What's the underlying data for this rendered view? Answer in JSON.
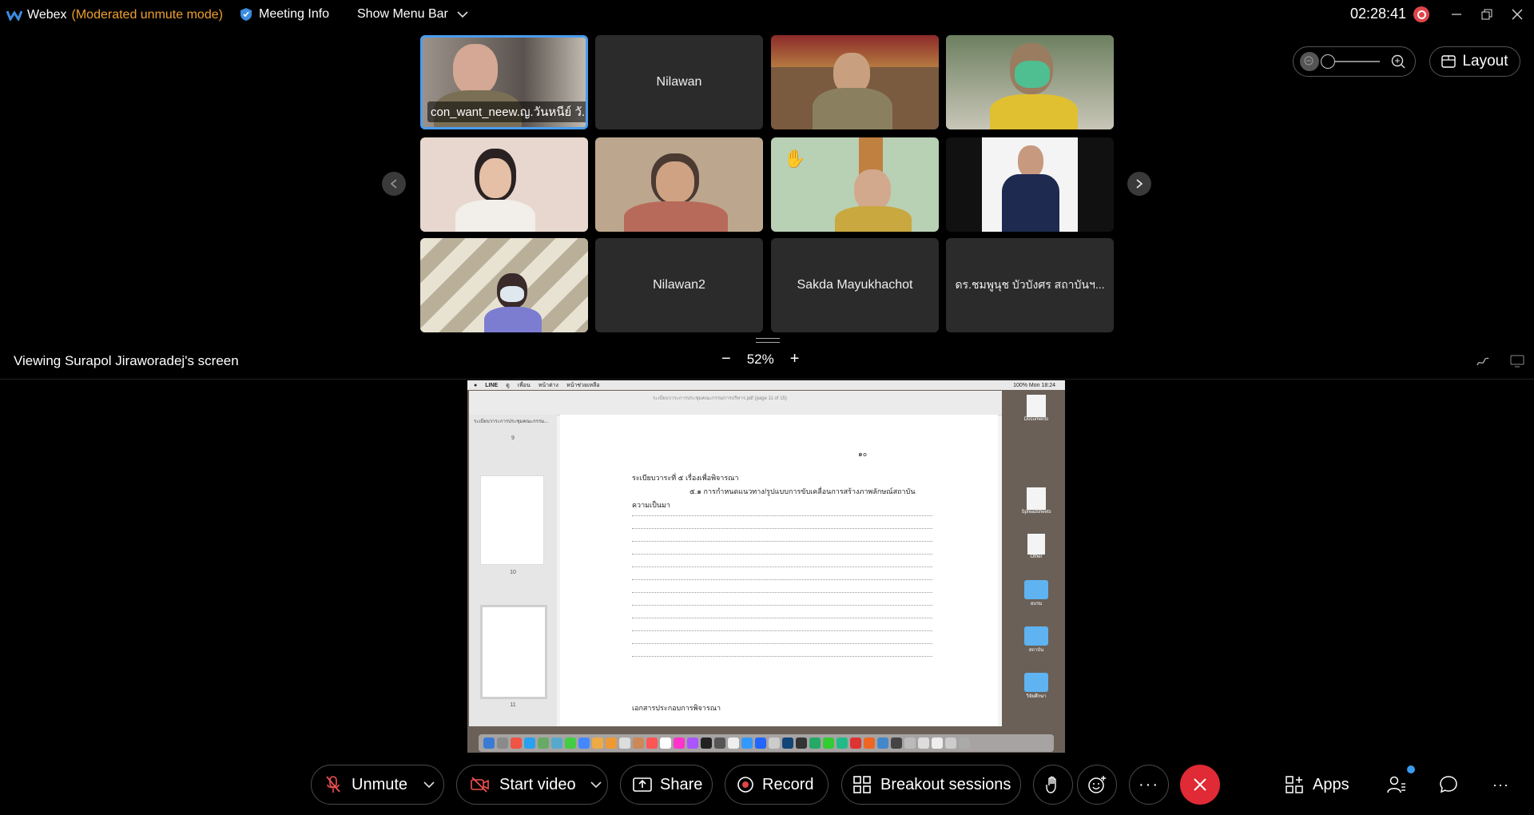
{
  "titlebar": {
    "app_name": "Webex",
    "mode": "(Moderated unmute mode)",
    "meeting_info": "Meeting Info",
    "show_menu_bar": "Show Menu Bar",
    "time": "02:28:41"
  },
  "participants": [
    {
      "name": "con_want_neew.ญ.วันหนีย์ วั...",
      "video": true,
      "active": true
    },
    {
      "name": "Nilawan",
      "video": false
    },
    {
      "name": "",
      "video": true
    },
    {
      "name": "",
      "video": true
    },
    {
      "name": "",
      "video": true
    },
    {
      "name": "",
      "video": true
    },
    {
      "name": "",
      "video": true,
      "raised_hand": true
    },
    {
      "name": "",
      "video": true
    },
    {
      "name": "",
      "video": true
    },
    {
      "name": "Nilawan2",
      "video": false
    },
    {
      "name": "Sakda Mayukhachot",
      "video": false
    },
    {
      "name": "ดร.ชมพูนุช บัวบังศร สถาบันฯ...",
      "video": false
    }
  ],
  "layout_button": "Layout",
  "share": {
    "viewing_label": "Viewing Surapol Jiraworadej's screen",
    "zoom": "52%",
    "mac_menu": [
      "LINE",
      "ดู",
      "เพื่อน",
      "หน้าต่าง",
      "หน้าช่วยเหลือ"
    ],
    "mac_clock": "100%  Mon 18:24",
    "preview_title": "ระเบียบวาระการประชุมคณะกรรมการบริหาร.pdf (page 11 of 15)",
    "sidebar_header": "ระเบียบวาระการประชุมคณะกรรม...",
    "page_numbers": [
      "9",
      "10",
      "11"
    ],
    "doc": {
      "page_no": "๑๐",
      "agenda": "ระเบียบวาระที่ ๕   เรื่องเพื่อพิจารณา",
      "item": "๕.๑ การกำหนดแนวทาง/รูปแบบการขับเคลื่อนการสร้างภาพลักษณ์สถาบัน",
      "background": "ความเป็นมา",
      "docs": "เอกสารประกอบการพิจารณา"
    },
    "desktop_icons": [
      "Documents",
      "Spreadsheets",
      "Other",
      "อบรม",
      "สถาบัน",
      "วิจัยศึกษา"
    ]
  },
  "toolbar": {
    "unmute": "Unmute",
    "start_video": "Start video",
    "share": "Share",
    "record": "Record",
    "breakout": "Breakout sessions",
    "apps": "Apps"
  },
  "colors": {
    "accent": "#4b9cf0",
    "end": "#e02a35",
    "mode": "#f0a030",
    "record": "#e0454a"
  }
}
